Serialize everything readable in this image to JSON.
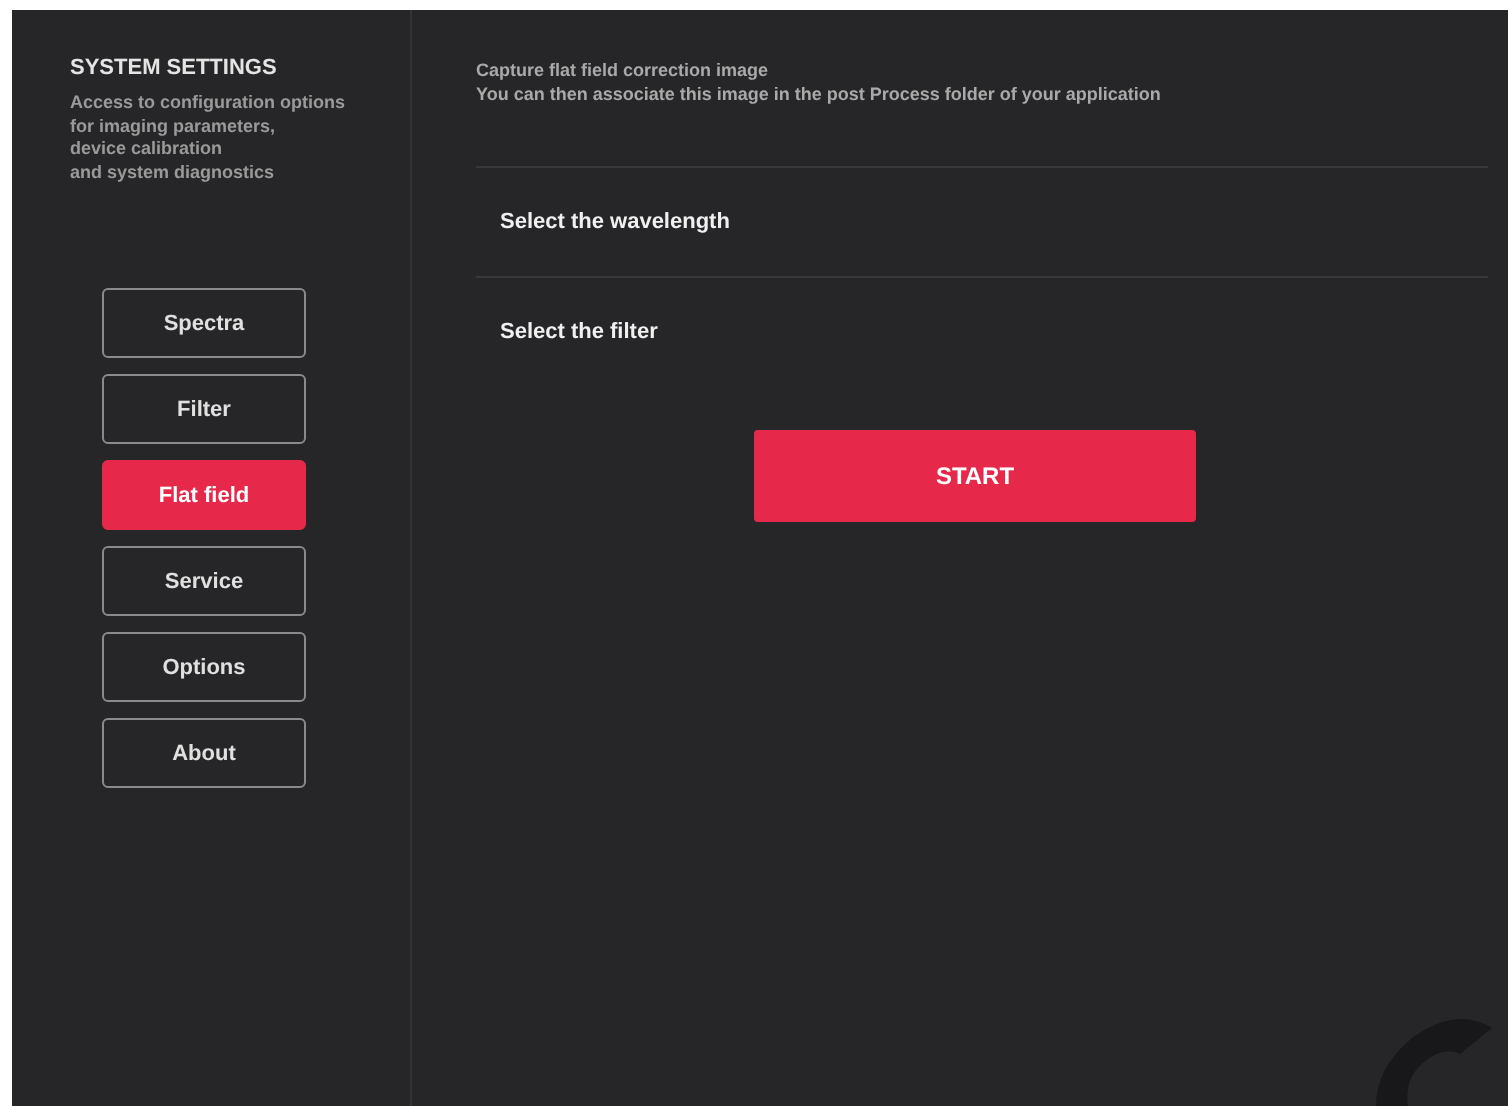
{
  "sidebar": {
    "title": "SYSTEM SETTINGS",
    "description": [
      "Access to configuration options",
      "for imaging parameters,",
      "device calibration",
      "and system diagnostics"
    ],
    "items": [
      {
        "label": "Spectra",
        "selected": false
      },
      {
        "label": "Filter",
        "selected": false
      },
      {
        "label": "Flat field",
        "selected": true
      },
      {
        "label": "Service",
        "selected": false
      },
      {
        "label": "Options",
        "selected": false
      },
      {
        "label": "About",
        "selected": false
      }
    ]
  },
  "main": {
    "intro": [
      "Capture flat field correction image",
      "You can then associate this image in the post Process folder of your application"
    ],
    "options": [
      "Select the wavelength",
      "Select the filter"
    ],
    "start_button": "START"
  }
}
